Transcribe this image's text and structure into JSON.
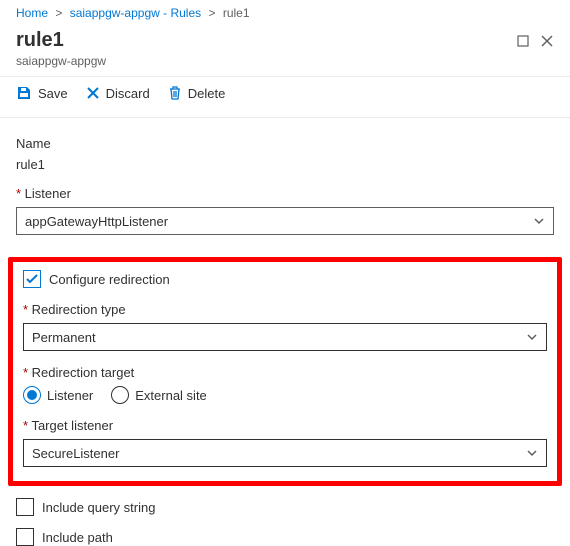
{
  "breadcrumb": {
    "home": "Home",
    "parent": "saiappgw-appgw - Rules",
    "current": "rule1"
  },
  "header": {
    "title": "rule1",
    "subtitle": "saiappgw-appgw"
  },
  "toolbar": {
    "save": "Save",
    "discard": "Discard",
    "delete": "Delete"
  },
  "form": {
    "name_label": "Name",
    "name_value": "rule1",
    "listener_label": "Listener",
    "listener_value": "appGatewayHttpListener",
    "configure_redirection": "Configure redirection",
    "redirection_type_label": "Redirection type",
    "redirection_type_value": "Permanent",
    "redirection_target_label": "Redirection target",
    "radio_listener": "Listener",
    "radio_external": "External site",
    "target_listener_label": "Target listener",
    "target_listener_value": "SecureListener",
    "include_query": "Include query string",
    "include_path": "Include path"
  }
}
